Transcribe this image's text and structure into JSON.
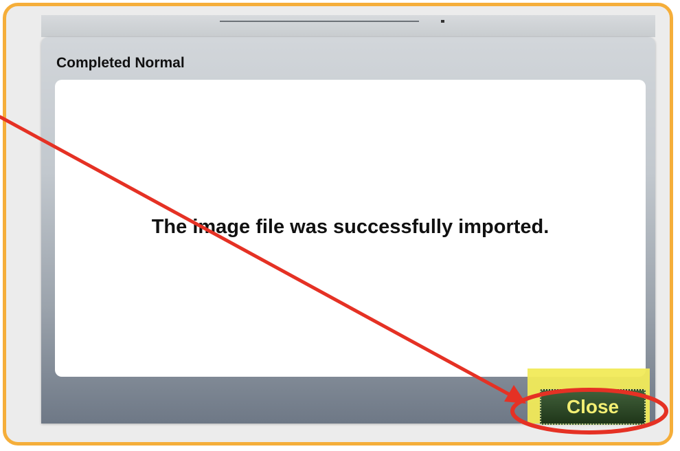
{
  "dialog": {
    "title": "Completed Normal",
    "message": "The image file was successfully imported.",
    "close_label": "Close"
  },
  "annotation": {
    "arrow_color": "#e53124",
    "circle_color": "#e53124",
    "frame_color": "#f5ae3a",
    "highlight_color": "#f1ea58"
  }
}
